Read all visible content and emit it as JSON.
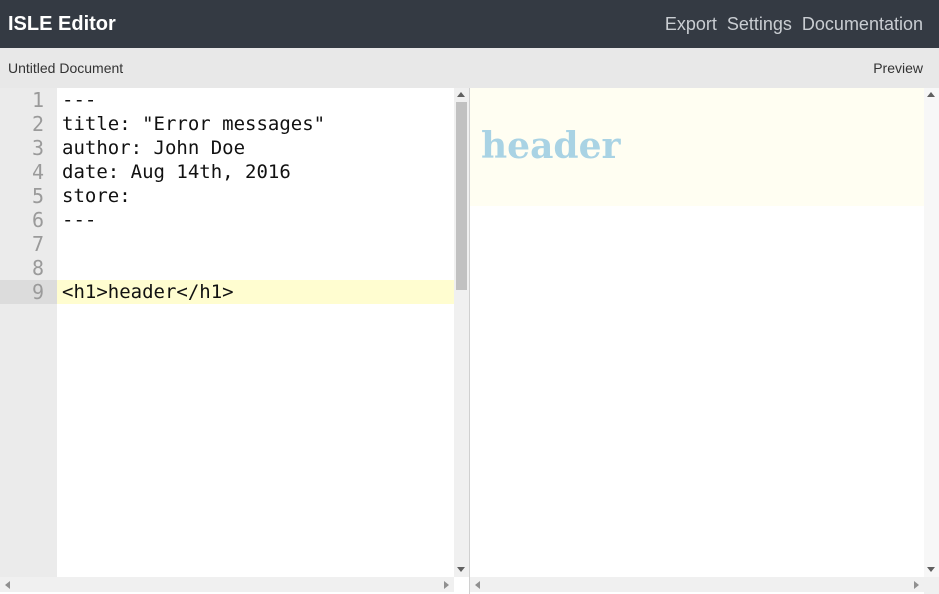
{
  "app": {
    "title": "ISLE Editor"
  },
  "nav": {
    "export": "Export",
    "settings": "Settings",
    "documentation": "Documentation"
  },
  "subbar": {
    "document_title": "Untitled Document",
    "preview_label": "Preview"
  },
  "editor": {
    "active_line": 9,
    "lines": [
      {
        "num": "1",
        "text": "---"
      },
      {
        "num": "2",
        "text": "title: \"Error messages\""
      },
      {
        "num": "3",
        "text": "author: John Doe"
      },
      {
        "num": "4",
        "text": "date: Aug 14th, 2016"
      },
      {
        "num": "5",
        "text": "store:"
      },
      {
        "num": "6",
        "text": "---"
      },
      {
        "num": "7",
        "text": ""
      },
      {
        "num": "8",
        "text": ""
      },
      {
        "num": "9",
        "text": "<h1>header</h1>"
      }
    ]
  },
  "preview": {
    "heading": "header"
  },
  "colors": {
    "topbar": "#343a43",
    "active_line": "#fffdd0",
    "preview_heading": "#a9d3e4",
    "preview_header_bg": "#fffef2"
  }
}
